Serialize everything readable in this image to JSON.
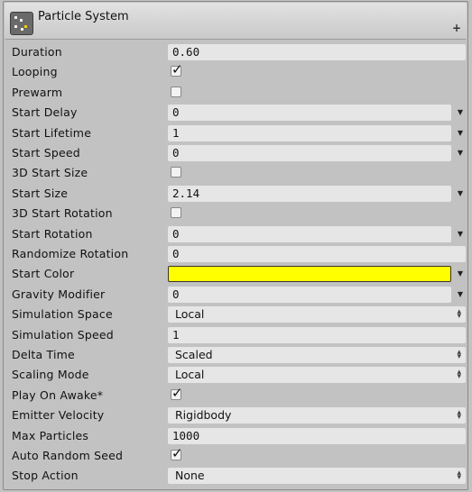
{
  "header": {
    "title": "Particle System",
    "add_label": "+"
  },
  "rows": [
    {
      "label": "Duration",
      "type": "value",
      "value": "0.60"
    },
    {
      "label": "Looping",
      "type": "check",
      "checked": true
    },
    {
      "label": "Prewarm",
      "type": "check",
      "checked": false
    },
    {
      "label": "Start Delay",
      "type": "curve",
      "value": "0"
    },
    {
      "label": "Start Lifetime",
      "type": "curve",
      "value": "1"
    },
    {
      "label": "Start Speed",
      "type": "curve",
      "value": "0"
    },
    {
      "label": "3D Start Size",
      "type": "check",
      "checked": false
    },
    {
      "label": "Start Size",
      "type": "curve",
      "value": "2.14"
    },
    {
      "label": "3D Start Rotation",
      "type": "check",
      "checked": false
    },
    {
      "label": "Start Rotation",
      "type": "curve",
      "value": "0"
    },
    {
      "label": "Randomize Rotation",
      "type": "value",
      "value": "0"
    },
    {
      "label": "Start Color",
      "type": "color",
      "color": "#ffff00"
    },
    {
      "label": "Gravity Modifier",
      "type": "curve",
      "value": "0"
    },
    {
      "label": "Simulation Space",
      "type": "enum",
      "value": "Local"
    },
    {
      "label": "Simulation Speed",
      "type": "value",
      "value": "1"
    },
    {
      "label": "Delta Time",
      "type": "enum",
      "value": "Scaled"
    },
    {
      "label": "Scaling Mode",
      "type": "enum",
      "value": "Local"
    },
    {
      "label": "Play On Awake*",
      "type": "check",
      "checked": true
    },
    {
      "label": "Emitter Velocity",
      "type": "enum",
      "value": "Rigidbody"
    },
    {
      "label": "Max Particles",
      "type": "value",
      "value": "1000"
    },
    {
      "label": "Auto Random Seed",
      "type": "check",
      "checked": true
    },
    {
      "label": "Stop Action",
      "type": "enum",
      "value": "None"
    }
  ],
  "icons": {
    "dropdown": "triangle-down-icon",
    "checkmark": "check-icon",
    "updown": "updown-arrows-icon"
  }
}
